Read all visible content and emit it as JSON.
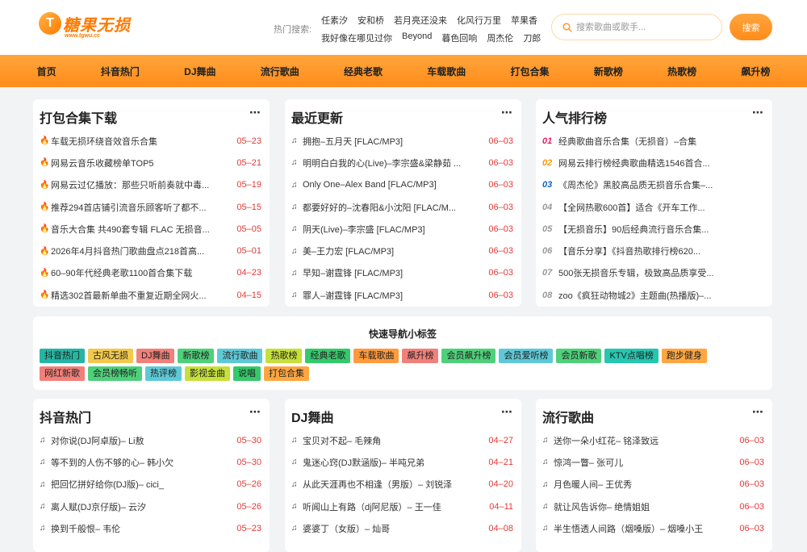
{
  "logo": {
    "badge": "T",
    "name": "糖果无损",
    "url": "www.tgwu.cc"
  },
  "header": {
    "hot_label": "热门搜索:",
    "hot_row1": [
      "任素汐",
      "安和桥",
      "若月亮还没来",
      "化风行万里",
      "苹果香"
    ],
    "hot_row2": [
      "我好像在哪见过你",
      "Beyond",
      "暮色回响",
      "周杰伦",
      "刀郎"
    ],
    "search_placeholder": "搜索歌曲或歌手...",
    "search_button": "搜索"
  },
  "nav": [
    "首页",
    "抖音热门",
    "DJ舞曲",
    "流行歌曲",
    "经典老歌",
    "车载歌曲",
    "打包合集",
    "新歌榜",
    "热歌榜",
    "飙升榜"
  ],
  "more_icon": "⋯",
  "packs": {
    "title": "打包合集下载",
    "items": [
      {
        "text": "车载无损环绕音效音乐合集",
        "date": "05–23"
      },
      {
        "text": "网易云音乐收藏榜单TOP5",
        "date": "05–21"
      },
      {
        "text": "网易云过亿播放：那些只听前奏就中毒...",
        "date": "05–19"
      },
      {
        "text": "推荐294首店铺引流音乐顾客听了都不...",
        "date": "05–15"
      },
      {
        "text": "音乐大合集 共490套专辑 FLAC 无损音...",
        "date": "05–05"
      },
      {
        "text": "2026年4月抖音热门歌曲盘点218首高...",
        "date": "05–01"
      },
      {
        "text": "60–90年代经典老歌1100首合集下载",
        "date": "04–23"
      },
      {
        "text": "精选302首最新单曲不重复近期全网火...",
        "date": "04–15"
      }
    ]
  },
  "latest": {
    "title": "最近更新",
    "items": [
      {
        "text": "拥抱–五月天 [FLAC/MP3]",
        "date": "06–03"
      },
      {
        "text": "明明白白我的心(Live)–李宗盛&梁静茹 ...",
        "date": "06–03"
      },
      {
        "text": "Only One–Alex Band [FLAC/MP3]",
        "date": "06–03"
      },
      {
        "text": "都要好好的–沈春阳&小沈阳 [FLAC/M...",
        "date": "06–03"
      },
      {
        "text": "阴天(Live)–李宗盛 [FLAC/MP3]",
        "date": "06–03"
      },
      {
        "text": "美–王力宏 [FLAC/MP3]",
        "date": "06–03"
      },
      {
        "text": "早知–谢霆锋 [FLAC/MP3]",
        "date": "06–03"
      },
      {
        "text": "罪人–谢霆锋 [FLAC/MP3]",
        "date": "06–03"
      }
    ]
  },
  "popular": {
    "title": "人气排行榜",
    "rank_colors": [
      "#e91e63",
      "#ff9800",
      "#1565c0",
      "#999999",
      "#999999",
      "#999999",
      "#999999",
      "#999999"
    ],
    "items": [
      {
        "rank": "01",
        "text": "经典歌曲音乐合集（无损音）–合集"
      },
      {
        "rank": "02",
        "text": "网易云排行榜经典歌曲精选1546首合..."
      },
      {
        "rank": "03",
        "text": "《周杰伦》黑胶高品质无损音乐合集–..."
      },
      {
        "rank": "04",
        "text": "【全网热歌600首】适合《开车工作..."
      },
      {
        "rank": "05",
        "text": "【无损音乐】90后经典流行音乐合集..."
      },
      {
        "rank": "06",
        "text": "【音乐分享】《抖音热歌排行榜620..."
      },
      {
        "rank": "07",
        "text": "500张无损音乐专辑，极致高品质享受..."
      },
      {
        "rank": "08",
        "text": "zoo《疯狂动物城2》主题曲(热播版)–..."
      }
    ]
  },
  "tags_section": {
    "title": "快速导航小标签",
    "tags": [
      {
        "label": "抖音热门",
        "color": "#26b5a3"
      },
      {
        "label": "古风无损",
        "color": "#f2c94c"
      },
      {
        "label": "DJ舞曲",
        "color": "#f2807a"
      },
      {
        "label": "新歌榜",
        "color": "#4fd07a"
      },
      {
        "label": "流行歌曲",
        "color": "#5ec9d6"
      },
      {
        "label": "热歌榜",
        "color": "#c6e03a"
      },
      {
        "label": "经典老歌",
        "color": "#35c96b"
      },
      {
        "label": "车载歌曲",
        "color": "#ff9a3d"
      },
      {
        "label": "飙升榜",
        "color": "#f2807a"
      },
      {
        "label": "会员飙升榜",
        "color": "#4fd07a"
      },
      {
        "label": "会员爱听榜",
        "color": "#5ec9d6"
      },
      {
        "label": "会员新歌",
        "color": "#4fd07a"
      },
      {
        "label": "KTV点唱榜",
        "color": "#26c6b0"
      },
      {
        "label": "跑步健身",
        "color": "#ffa640"
      },
      {
        "label": "网红新歌",
        "color": "#f2807a"
      },
      {
        "label": "会员榜畅听",
        "color": "#4fd07a"
      },
      {
        "label": "热评榜",
        "color": "#5ec9d6"
      },
      {
        "label": "影视金曲",
        "color": "#c6e03a"
      },
      {
        "label": "说唱",
        "color": "#35c96b"
      },
      {
        "label": "打包合集",
        "color": "#ffa640"
      }
    ]
  },
  "douyin": {
    "title": "抖音热门",
    "items": [
      {
        "text": "对你说(DJ阿卓版)– Li敖",
        "date": "05–30"
      },
      {
        "text": "等不到的人伤不够的心– 韩小欠",
        "date": "05–30"
      },
      {
        "text": "把回忆拼好给你(DJ版)– cici_",
        "date": "05–26"
      },
      {
        "text": "离人赋(DJ京仔版)– 云汐",
        "date": "05–26"
      },
      {
        "text": "换到千般恨– 韦伦",
        "date": "05–23"
      }
    ]
  },
  "dj": {
    "title": "DJ舞曲",
    "items": [
      {
        "text": "宝贝对不起– 毛辣角",
        "date": "04–27"
      },
      {
        "text": "鬼迷心窍(DJ默涵版)– 半吨兄弟",
        "date": "04–21"
      },
      {
        "text": "从此天涯再也不相逢（男版）– 刘锐泽",
        "date": "04–20"
      },
      {
        "text": "听闻山上有路（dj阿尼版）– 王一佳",
        "date": "04–11"
      },
      {
        "text": "婆婆丁（女版）– 灿哥",
        "date": "04–08"
      }
    ]
  },
  "pop": {
    "title": "流行歌曲",
    "items": [
      {
        "text": "送你一朵小红花– 铭泽致远",
        "date": "06–03"
      },
      {
        "text": "惊鸿一瞥– 张可儿",
        "date": "06–03"
      },
      {
        "text": "月色暖人间– 王优秀",
        "date": "06–03"
      },
      {
        "text": "就让风告诉你– 绝情姐姐",
        "date": "06–03"
      },
      {
        "text": "半生悟透人间路（烟嗓版）– 烟嗓小王",
        "date": "06–03"
      }
    ]
  }
}
